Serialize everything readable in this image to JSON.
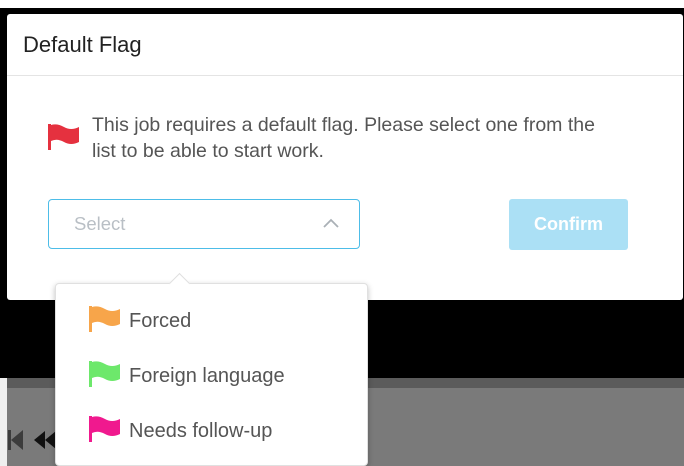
{
  "modal": {
    "title": "Default Flag",
    "notice_text": "This job requires a default flag. Please select one from the list to be able to start work.",
    "notice_icon": "flag-icon",
    "notice_icon_color": "#e5313f"
  },
  "select": {
    "placeholder": "Select",
    "state": "open",
    "chevron_icon": "chevron-up-icon",
    "border_color": "#4dbde8"
  },
  "confirm_button": {
    "label": "Confirm",
    "disabled": true,
    "color": "#abe0f5"
  },
  "dropdown": {
    "options": [
      {
        "label": "Forced",
        "icon": "flag-icon",
        "color": "#f7a54a"
      },
      {
        "label": "Foreign language",
        "icon": "flag-icon",
        "color": "#6de86b"
      },
      {
        "label": "Needs follow-up",
        "icon": "flag-icon",
        "color": "#f0198e"
      }
    ]
  },
  "player_controls": {
    "icons": [
      "skip-to-start-icon",
      "rewind-icon"
    ]
  }
}
